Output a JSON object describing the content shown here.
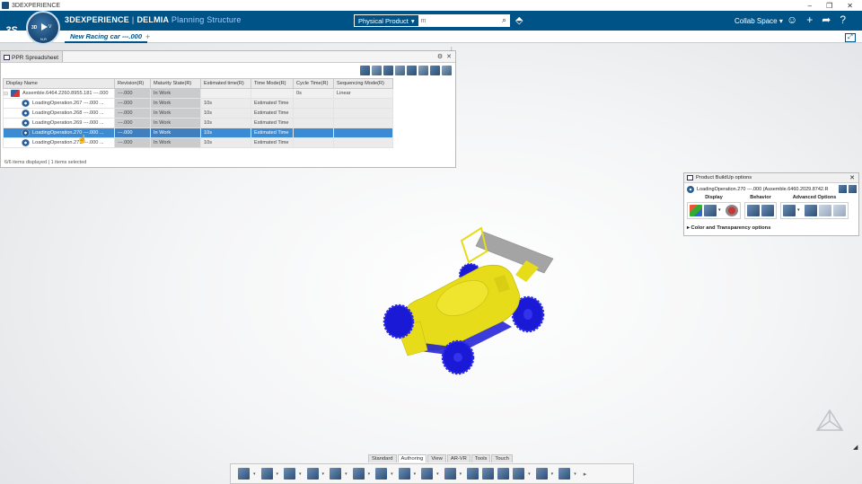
{
  "window": {
    "title": "3DEXPERIENCE",
    "controls": [
      "–",
      "❐",
      "✕"
    ]
  },
  "topbar": {
    "brand_bold": "3DEXPERIENCE",
    "brand_company": "DELMIA",
    "brand_app": "Planning Structure",
    "compass": {
      "label_3d": "3D",
      "label_v": "V",
      "label_nr": "N,R"
    },
    "search": {
      "context": "Physical Product",
      "placeholder": "m"
    },
    "collab_space": "Collab Space"
  },
  "tabs": {
    "active": "New Racing car ---.000",
    "add": "+"
  },
  "ppr": {
    "title": "PPR Spreadsheet",
    "columns": [
      "Display Name",
      "Revision(R)",
      "Maturity State(R)",
      "Estimated time(R)",
      "Time Mode(R)",
      "Cycle Time(R)",
      "Sequencing Mode(R)"
    ],
    "rows": [
      {
        "name": "Assemble.6464.2260.8955.181 ---.000",
        "revision": "---.000",
        "maturity": "In Work",
        "estimated": "",
        "timemode": "",
        "cycle": "0s",
        "sequencing": "Linear"
      },
      {
        "name": "LoadingOperation.267 ---.000 ...",
        "revision": "---.000",
        "maturity": "In Work",
        "estimated": "10s",
        "timemode": "Estimated Time",
        "cycle": "",
        "sequencing": ""
      },
      {
        "name": "LoadingOperation.268 ---.000 ...",
        "revision": "---.000",
        "maturity": "In Work",
        "estimated": "10s",
        "timemode": "Estimated Time",
        "cycle": "",
        "sequencing": ""
      },
      {
        "name": "LoadingOperation.269 ---.000 ...",
        "revision": "---.000",
        "maturity": "In Work",
        "estimated": "10s",
        "timemode": "Estimated Time",
        "cycle": "",
        "sequencing": ""
      },
      {
        "name": "LoadingOperation.270 ---.000 ...",
        "revision": "---.000",
        "maturity": "In Work",
        "estimated": "10s",
        "timemode": "Estimated Time",
        "cycle": "",
        "sequencing": ""
      },
      {
        "name": "LoadingOperation.271 ---.000 ...",
        "revision": "---.000",
        "maturity": "In Work",
        "estimated": "10s",
        "timemode": "Estimated Time",
        "cycle": "",
        "sequencing": ""
      }
    ],
    "selected_row": 4,
    "status": "6/6 items displayed | 1 items selected"
  },
  "pbu": {
    "title": "Product BuildUp options",
    "target": "LoadingOperation.270 ---.000 (Assemble.6460.2029.8742.R",
    "groups": {
      "display": "Display",
      "behavior": "Behavior",
      "advanced": "Advanced Options"
    },
    "color_section": "Color and Transparency options"
  },
  "action_bar": {
    "tabs": [
      "Standard",
      "Authoring",
      "View",
      "AR-VR",
      "Tools",
      "Touch"
    ],
    "active_tab": "Authoring"
  },
  "colors": {
    "brand_blue": "#005386",
    "selection": "#3b8ad4",
    "car_body": "#e6dc1a",
    "car_wheels": "#1a1ad6"
  }
}
